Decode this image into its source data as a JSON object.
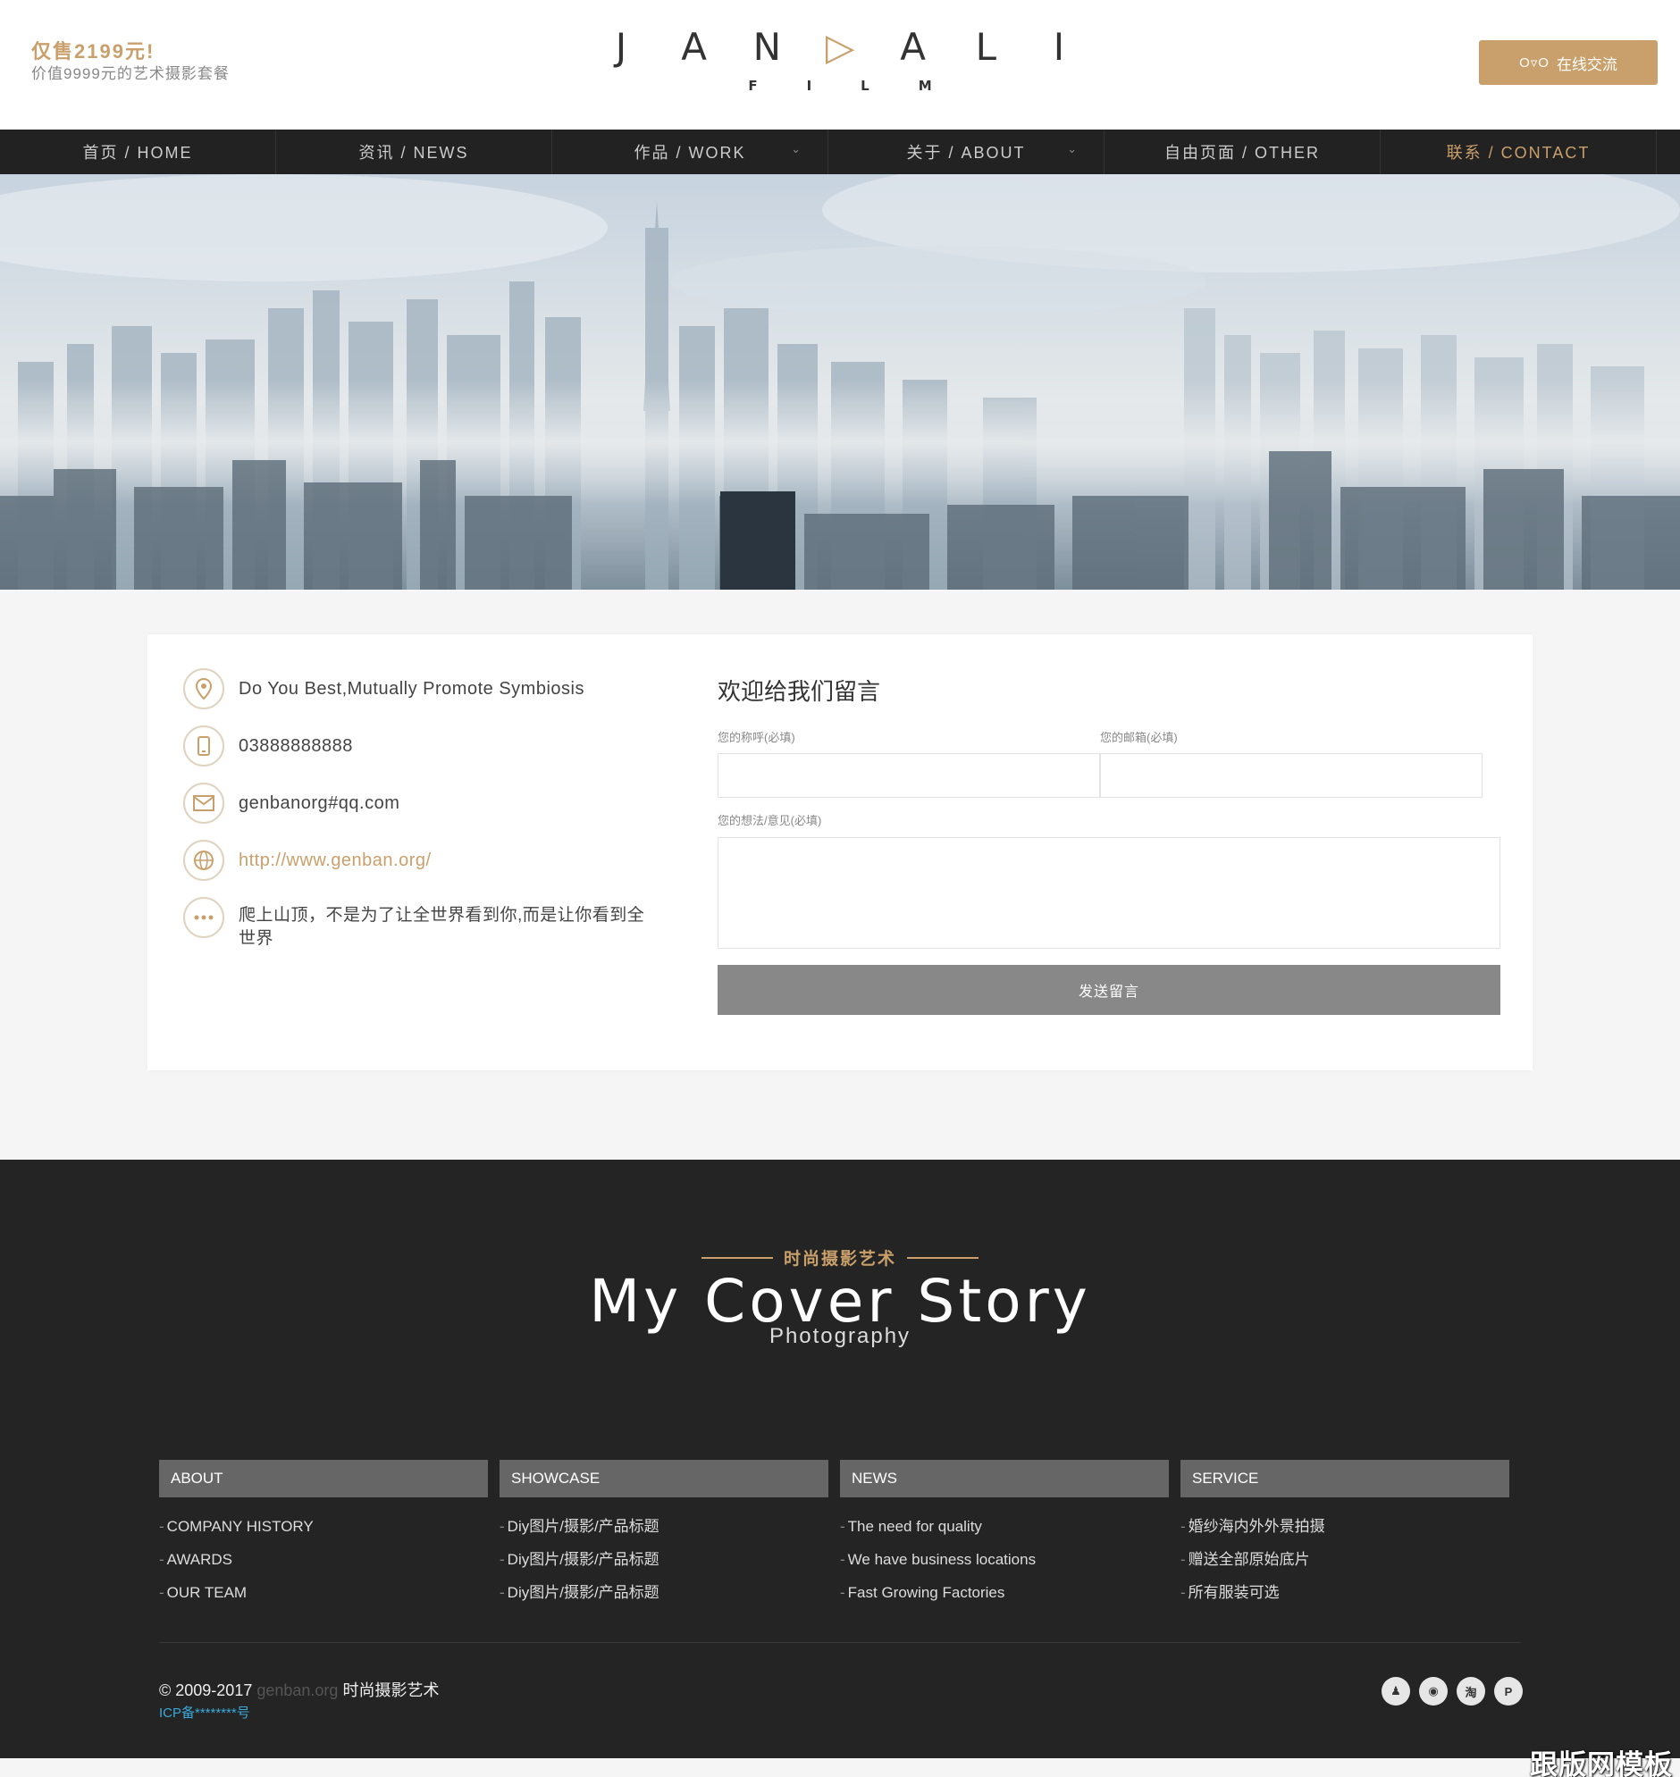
{
  "header": {
    "promo_title": "仅售2199元!",
    "promo_sub": "价值9999元的艺术摄影套餐",
    "logo_letters": [
      "J",
      "A",
      "N",
      "▷",
      "A",
      "L",
      "I"
    ],
    "logo_sub": [
      "F",
      "I",
      "L",
      "M"
    ],
    "chat_icon": "qq-icon",
    "chat_qq": "O▿O",
    "chat_label": "在线交流"
  },
  "nav": {
    "items": [
      {
        "label": "首页 / HOME"
      },
      {
        "label": "资讯 / NEWS"
      },
      {
        "label": "作品 / WORK"
      },
      {
        "label": "关于 / ABOUT"
      },
      {
        "label": "自由页面 / OTHER"
      },
      {
        "label": "联系 / CONTACT"
      }
    ],
    "chevron": "⌄",
    "active_color": "#c9a06b"
  },
  "contact": {
    "slogan": "Do You Best,Mutually Promote Symbiosis",
    "phone": "03888888888",
    "email": "genbanorg#qq.com",
    "website": "http://www.genban.org/",
    "motto": "爬上山顶，不是为了让全世界看到你,而是让你看到全世界"
  },
  "form": {
    "title": "欢迎给我们留言",
    "name_label": "您的称呼",
    "email_label": "您的邮箱",
    "message_label": "您的想法/意见",
    "required": "(必填)",
    "submit": "发送留言"
  },
  "footer": {
    "brand_cn": "时尚摄影艺术",
    "brand_main": "My Cover Story",
    "brand_sub": "Photography",
    "columns": [
      {
        "title": "ABOUT",
        "items": [
          "COMPANY HISTORY",
          "AWARDS",
          "OUR TEAM"
        ]
      },
      {
        "title": "SHOWCASE",
        "items": [
          "Diy图片/摄影/产品标题",
          "Diy图片/摄影/产品标题",
          "Diy图片/摄影/产品标题"
        ]
      },
      {
        "title": "NEWS",
        "items": [
          "The need for quality",
          "We have business locations",
          "Fast Growing Factories"
        ]
      },
      {
        "title": "SERVICE",
        "items": [
          "婚纱海内外外景拍摄",
          "赠送全部原始底片",
          "所有服装可选"
        ]
      }
    ],
    "copyright": "© 2009-2017",
    "copyright_site": "genban.org",
    "copyright_name": "时尚摄影艺术",
    "icp": "ICP备********号",
    "social": [
      {
        "icon": "qq-icon",
        "glyph": "♟"
      },
      {
        "icon": "weibo-icon",
        "glyph": "◉"
      },
      {
        "icon": "taobao-icon",
        "glyph": "淘"
      },
      {
        "icon": "pinterest-icon",
        "glyph": "P"
      }
    ]
  },
  "watermark": "跟版网模板",
  "colors": {
    "accent": "#c9a06b",
    "nav_bg": "#222222",
    "footer_bg": "#242424",
    "button_gray": "#888888",
    "icp_link": "#3aa9d8"
  }
}
